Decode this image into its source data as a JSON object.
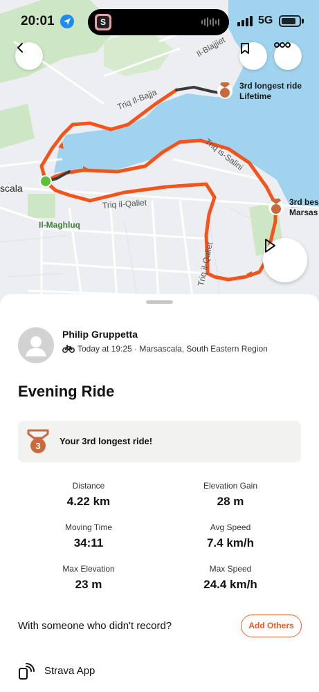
{
  "status_bar": {
    "time": "20:01",
    "network": "5G"
  },
  "map": {
    "streets": [
      "Il-Blajjiet",
      "Triq Il-Bajja",
      "Triq is-Salini",
      "Triq il-Qaliet",
      "Triq il-Qaliet"
    ],
    "place_partial": "scala",
    "area_label": "Il-Maghluq",
    "milestones": [
      {
        "line1": "3rd longest ride",
        "line2": "Lifetime",
        "medal": "3"
      },
      {
        "line1": "3rd bes",
        "line2": "Marsas",
        "medal": "3"
      }
    ],
    "colors": {
      "route": "#f2541b",
      "water": "#9fd3ee",
      "start": "#5fc13a",
      "medal": "#c86a3c"
    }
  },
  "header_buttons": {
    "back": "chevron-left-icon",
    "save": "bookmark-icon",
    "more": "more-icon"
  },
  "athlete": {
    "name": "Philip Gruppetta",
    "meta": "Today at 19:25 · Marsascala, South Eastern Region"
  },
  "activity": {
    "title": "Evening Ride"
  },
  "achievement": {
    "medal": "3",
    "text": "Your 3rd longest ride!"
  },
  "stats": [
    {
      "label": "Distance",
      "value": "4.22 km"
    },
    {
      "label": "Elevation Gain",
      "value": "28 m"
    },
    {
      "label": "Moving Time",
      "value": "34:11"
    },
    {
      "label": "Avg Speed",
      "value": "7.4 km/h"
    },
    {
      "label": "Max Elevation",
      "value": "23 m"
    },
    {
      "label": "Max Speed",
      "value": "24.4 km/h"
    }
  ],
  "with_others": {
    "text": "With someone who didn't record?",
    "button": "Add Others"
  },
  "device": {
    "label": "Strava App"
  },
  "accent": "#e85a1f"
}
